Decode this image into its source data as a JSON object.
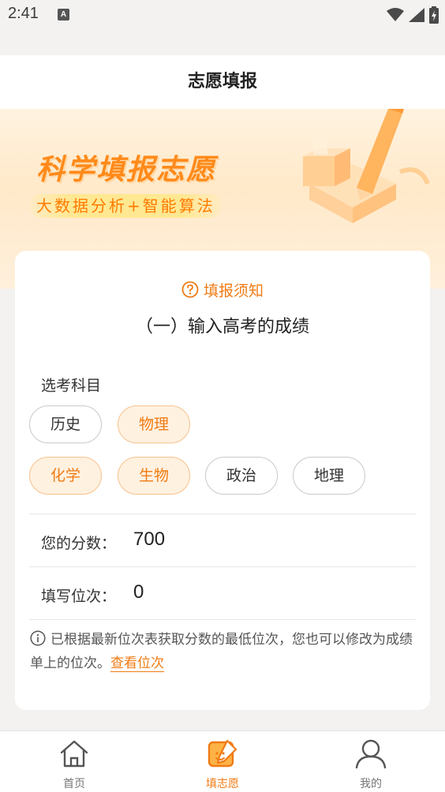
{
  "status_bar": {
    "time": "2:41",
    "keyboard_indicator": "A"
  },
  "header": {
    "title": "志愿填报"
  },
  "banner": {
    "title": "科学填报志愿",
    "subtitle": "大数据分析+智能算法"
  },
  "card": {
    "notice_label": "填报须知",
    "section_title": "（一）输入高考的成绩",
    "subjects_label": "选考科目",
    "subjects": [
      {
        "label": "历史",
        "selected": false
      },
      {
        "label": "物理",
        "selected": true
      },
      {
        "label": "化学",
        "selected": true
      },
      {
        "label": "生物",
        "selected": true
      },
      {
        "label": "政治",
        "selected": false
      },
      {
        "label": "地理",
        "selected": false
      }
    ],
    "score_label": "您的分数：",
    "score_value": "700",
    "rank_label": "填写位次：",
    "rank_value": "0",
    "info_text": "已根据最新位次表获取分数的最低位次，您也可以修改为成绩单上的位次。",
    "info_link": "查看位次"
  },
  "bottom_nav": {
    "items": [
      {
        "label": "首页",
        "icon": "home-icon",
        "active": false
      },
      {
        "label": "填志愿",
        "icon": "edit-form-icon",
        "active": true
      },
      {
        "label": "我的",
        "icon": "user-icon",
        "active": false
      }
    ]
  },
  "colors": {
    "accent": "#f07b14",
    "chip_selected_bg": "#fff1e0",
    "page_bg": "#f3f2f1"
  }
}
